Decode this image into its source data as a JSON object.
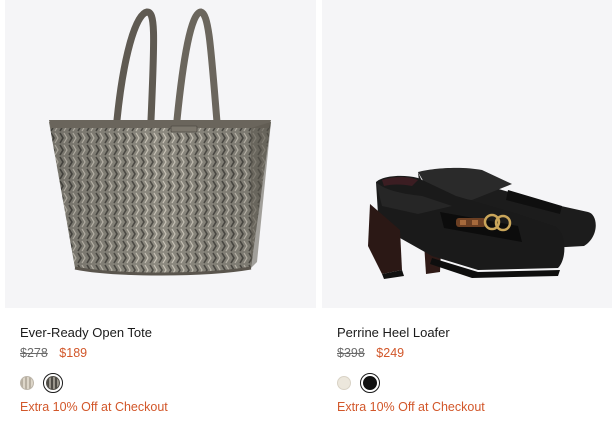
{
  "products": [
    {
      "name": "Ever-Ready Open Tote",
      "original_price": "$278",
      "sale_price": "$189",
      "promo": "Extra 10% Off at Checkout",
      "image": "tote-bag-image",
      "swatches": [
        {
          "color": "#c9c0b3",
          "pattern": "monogram-light",
          "selected": false
        },
        {
          "color": "#6e6b63",
          "pattern": "monogram-dark",
          "selected": true
        }
      ]
    },
    {
      "name": "Perrine Heel Loafer",
      "original_price": "$398",
      "sale_price": "$249",
      "promo": "Extra 10% Off at Checkout",
      "image": "loafer-image",
      "swatches": [
        {
          "color": "#ece7dc",
          "pattern": "solid",
          "selected": false
        },
        {
          "color": "#111111",
          "pattern": "solid",
          "selected": true
        }
      ]
    }
  ],
  "colors": {
    "sale": "#d2572a",
    "original": "#6b6b6b",
    "image_bg": "#f5f5f7"
  }
}
